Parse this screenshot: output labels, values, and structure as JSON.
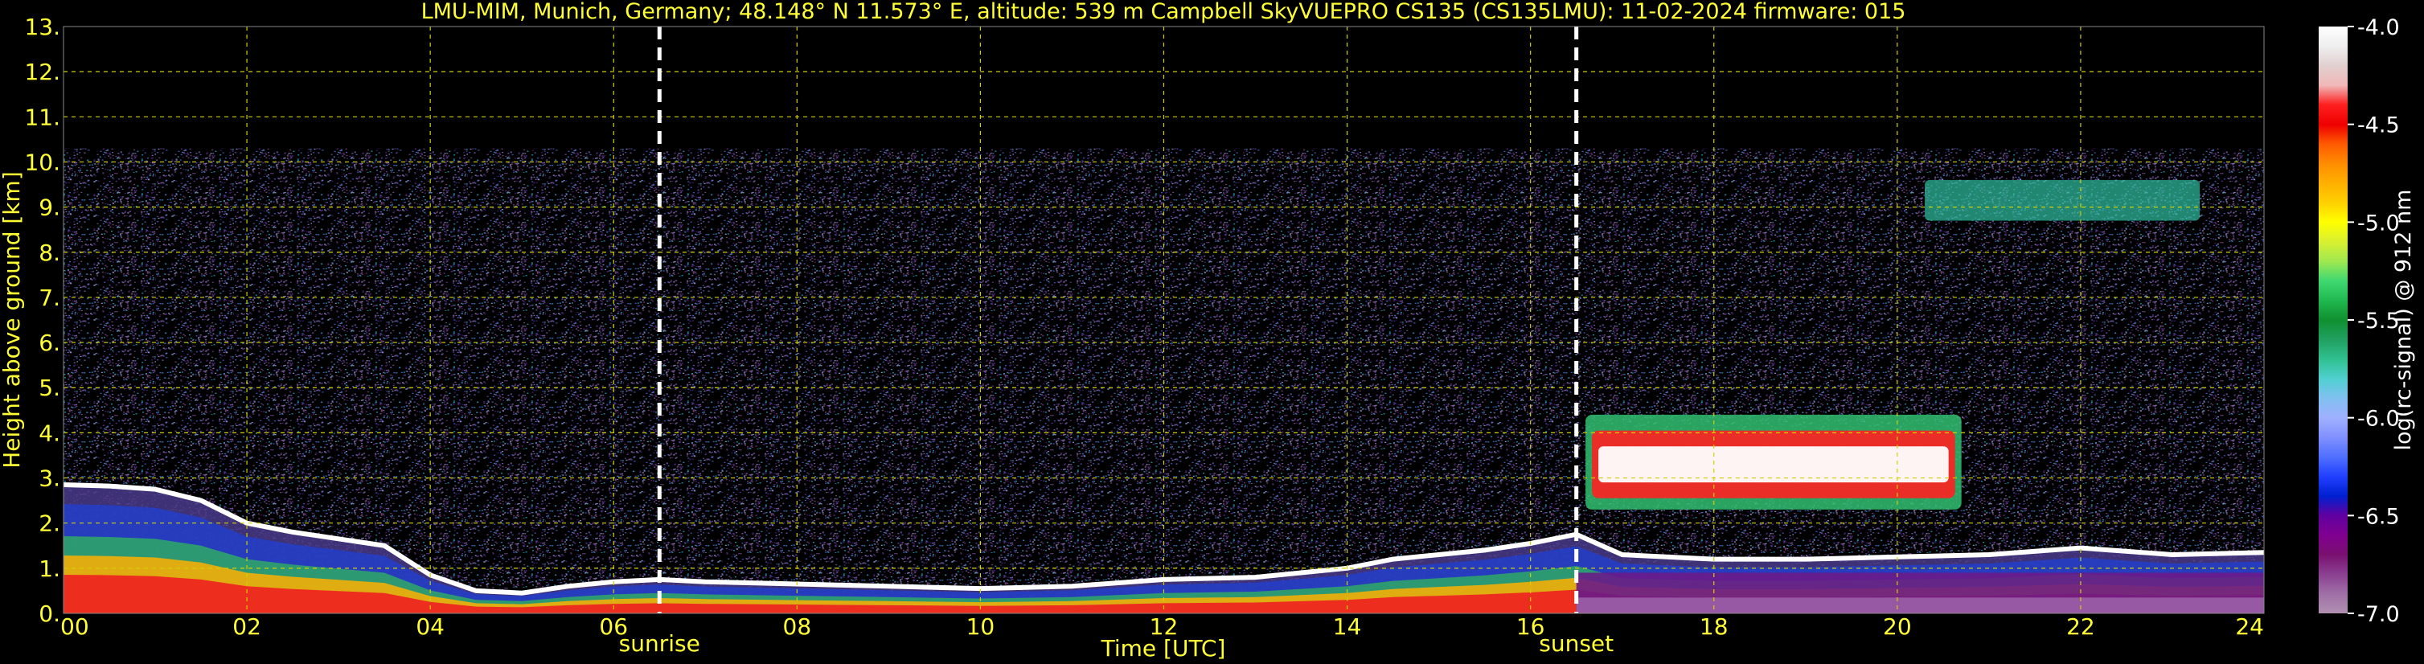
{
  "chart_data": {
    "type": "heatmap",
    "title": "LMU-MIM, Munich, Germany; 48.148° N 11.573° E, altitude: 539 m    Campbell SkyVUEPRO CS135 (CS135LMU): 11-02-2024    firmware: 015",
    "xlabel": "Time [UTC]",
    "ylabel": "Height above ground [km]",
    "xlim": [
      0,
      24
    ],
    "ylim": [
      0,
      13
    ],
    "x_ticks": [
      "00",
      "02",
      "04",
      "06",
      "08",
      "10",
      "12",
      "14",
      "16",
      "18",
      "20",
      "22",
      "24"
    ],
    "y_ticks": [
      "0.",
      "1.",
      "2.",
      "3.",
      "4.",
      "5.",
      "6.",
      "7.",
      "8.",
      "9.",
      "10.",
      "11.",
      "12.",
      "13."
    ],
    "grid": true,
    "markers": [
      {
        "label": "sunrise",
        "time_h": 6.5
      },
      {
        "label": "sunset",
        "time_h": 16.5
      }
    ],
    "colorbar": {
      "label": "log(rc-signal) @ 912 nm",
      "range": [
        -7.0,
        -4.0
      ],
      "ticks": [
        "-4.0",
        "-4.5",
        "-5.0",
        "-5.5",
        "-6.0",
        "-6.5",
        "-7.0"
      ],
      "colors": [
        "#ffffff",
        "#efefef",
        "#e2d0d0",
        "#f0b8b8",
        "#ff2020",
        "#ee0000",
        "#ff5a00",
        "#ff8c00",
        "#ffb000",
        "#ffd000",
        "#ffff00",
        "#d8f030",
        "#a0e850",
        "#40d870",
        "#20b850",
        "#109030",
        "#20a060",
        "#30c090",
        "#50d0d0",
        "#80c0f0",
        "#a0b0ff",
        "#8090ff",
        "#5070ff",
        "#2040ff",
        "#0020d0",
        "#6000a0",
        "#800090",
        "#7a1070",
        "#8a4090",
        "#a070a8",
        "#b090b0"
      ]
    },
    "bands": [
      {
        "name": "noise",
        "t0": 0,
        "t1": 24,
        "h0": 0.3,
        "h1": 10.3
      },
      {
        "name": "boundary_layer_top",
        "times": [
          0,
          0.5,
          1,
          1.5,
          2,
          2.5,
          3,
          3.5,
          4,
          4.5,
          5,
          5.5,
          6,
          6.5,
          7,
          8,
          9,
          10,
          11,
          12,
          13,
          14,
          14.5,
          15,
          15.5,
          16,
          16.5,
          17,
          18,
          19,
          20,
          21,
          22,
          23,
          24
        ],
        "heights": [
          2.85,
          2.82,
          2.75,
          2.5,
          2.0,
          1.8,
          1.65,
          1.5,
          0.85,
          0.5,
          0.45,
          0.6,
          0.7,
          0.75,
          0.7,
          0.65,
          0.6,
          0.55,
          0.6,
          0.75,
          0.8,
          1.0,
          1.2,
          1.3,
          1.4,
          1.55,
          1.75,
          1.3,
          1.2,
          1.2,
          1.25,
          1.3,
          1.45,
          1.3,
          1.35
        ]
      },
      {
        "name": "mid_cloud",
        "t0": 16.6,
        "t1": 20.7,
        "h0": 2.3,
        "h1": 4.4
      },
      {
        "name": "high_cloud",
        "t0": 20.3,
        "t1": 23.3,
        "h0": 8.7,
        "h1": 9.6
      }
    ]
  }
}
